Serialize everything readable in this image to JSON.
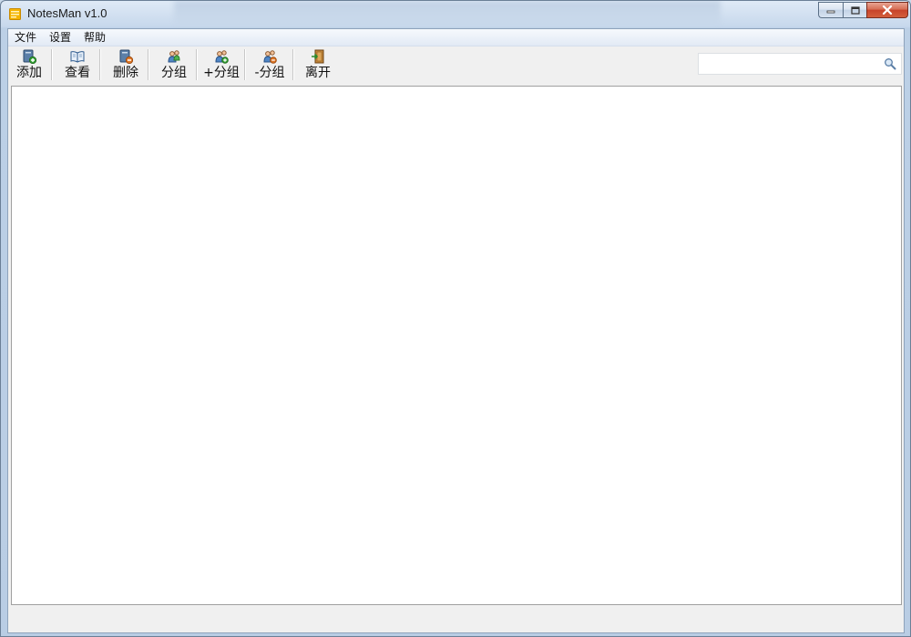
{
  "window": {
    "title": "NotesMan v1.0",
    "icon": "notes-app-icon",
    "controls": [
      "minimize-icon",
      "maximize-icon",
      "close-icon"
    ]
  },
  "menubar": {
    "items": [
      {
        "label": "文件"
      },
      {
        "label": "设置"
      },
      {
        "label": "帮助"
      }
    ]
  },
  "toolbar": {
    "buttons": [
      {
        "label": "添加",
        "icon": "add-note-icon"
      },
      {
        "label": "查看",
        "icon": "open-book-icon"
      },
      {
        "label": "删除",
        "icon": "delete-note-icon"
      },
      {
        "label": "分组",
        "icon": "group-icon"
      },
      {
        "label": "+分组",
        "icon": "add-group-icon"
      },
      {
        "label": "-分组",
        "icon": "remove-group-icon"
      },
      {
        "label": "离开",
        "icon": "exit-door-icon"
      }
    ]
  },
  "search": {
    "value": "",
    "placeholder": "",
    "icon": "search-icon"
  },
  "colors": {
    "accent": "#c7432a",
    "frame": "#b9cde4",
    "client": "#f0f0f0"
  }
}
